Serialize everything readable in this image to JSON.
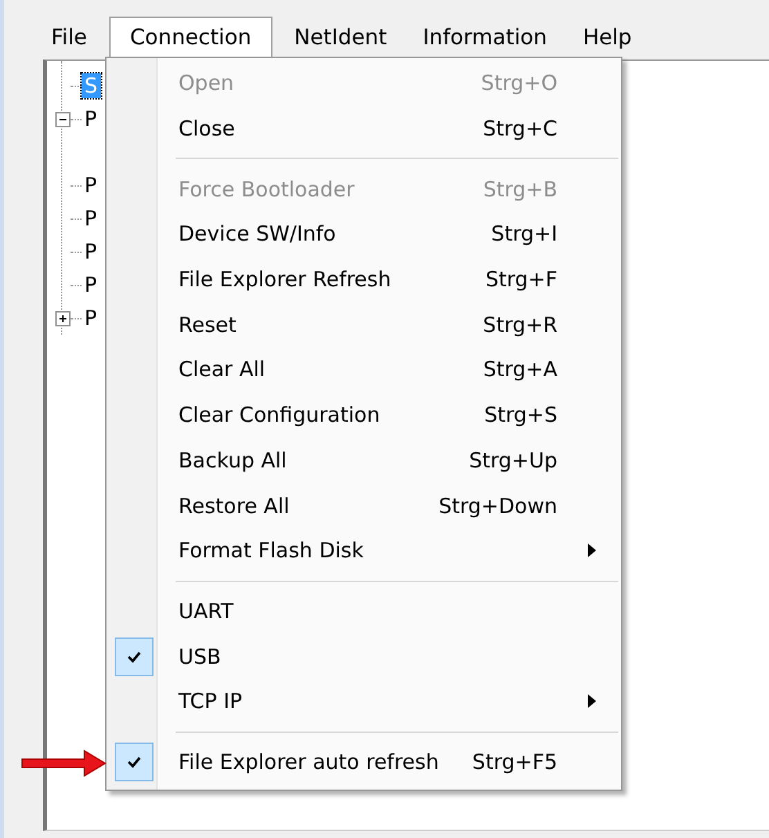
{
  "menubar": [
    {
      "label": "File",
      "selected": false
    },
    {
      "label": "Connection",
      "selected": true
    },
    {
      "label": "NetIdent",
      "selected": false
    },
    {
      "label": "Information",
      "selected": false
    },
    {
      "label": "Help",
      "selected": false
    }
  ],
  "tree": [
    {
      "label": "S",
      "selected": true
    },
    {
      "label": "P",
      "selected": false,
      "expanded": true
    },
    {
      "label": "P",
      "selected": false
    },
    {
      "label": "P",
      "selected": false
    },
    {
      "label": "P",
      "selected": false
    },
    {
      "label": "P",
      "selected": false
    },
    {
      "label": "P",
      "selected": false,
      "expanded": false
    }
  ],
  "menu": [
    {
      "kind": "item",
      "label": "Open",
      "shortcut": "Strg+O",
      "disabled": true,
      "checked": false
    },
    {
      "kind": "item",
      "label": "Close",
      "shortcut": "Strg+C",
      "disabled": false,
      "checked": false
    },
    {
      "kind": "separator"
    },
    {
      "kind": "item",
      "label": "Force Bootloader",
      "shortcut": "Strg+B",
      "disabled": true,
      "checked": false
    },
    {
      "kind": "item",
      "label": "Device SW/Info",
      "shortcut": "Strg+I",
      "disabled": false,
      "checked": false
    },
    {
      "kind": "item",
      "label": "File Explorer Refresh",
      "shortcut": "Strg+F",
      "disabled": false,
      "checked": false
    },
    {
      "kind": "item",
      "label": "Reset",
      "shortcut": "Strg+R",
      "disabled": false,
      "checked": false
    },
    {
      "kind": "item",
      "label": "Clear All",
      "shortcut": "Strg+A",
      "disabled": false,
      "checked": false
    },
    {
      "kind": "item",
      "label": "Clear Configuration",
      "shortcut": "Strg+S",
      "disabled": false,
      "checked": false
    },
    {
      "kind": "item",
      "label": "Backup All",
      "shortcut": "Strg+Up",
      "disabled": false,
      "checked": false
    },
    {
      "kind": "item",
      "label": "Restore All",
      "shortcut": "Strg+Down",
      "disabled": false,
      "checked": false
    },
    {
      "kind": "submenu",
      "label": "Format Flash Disk",
      "disabled": false,
      "checked": false
    },
    {
      "kind": "separator"
    },
    {
      "kind": "item",
      "label": "UART",
      "disabled": false,
      "checked": false
    },
    {
      "kind": "item",
      "label": "USB",
      "disabled": false,
      "checked": true
    },
    {
      "kind": "submenu",
      "label": "TCP IP",
      "disabled": false,
      "checked": false
    },
    {
      "kind": "separator"
    },
    {
      "kind": "item",
      "label": "File Explorer auto refresh",
      "shortcut": "Strg+F5",
      "disabled": false,
      "checked": true,
      "pointer": true
    }
  ]
}
